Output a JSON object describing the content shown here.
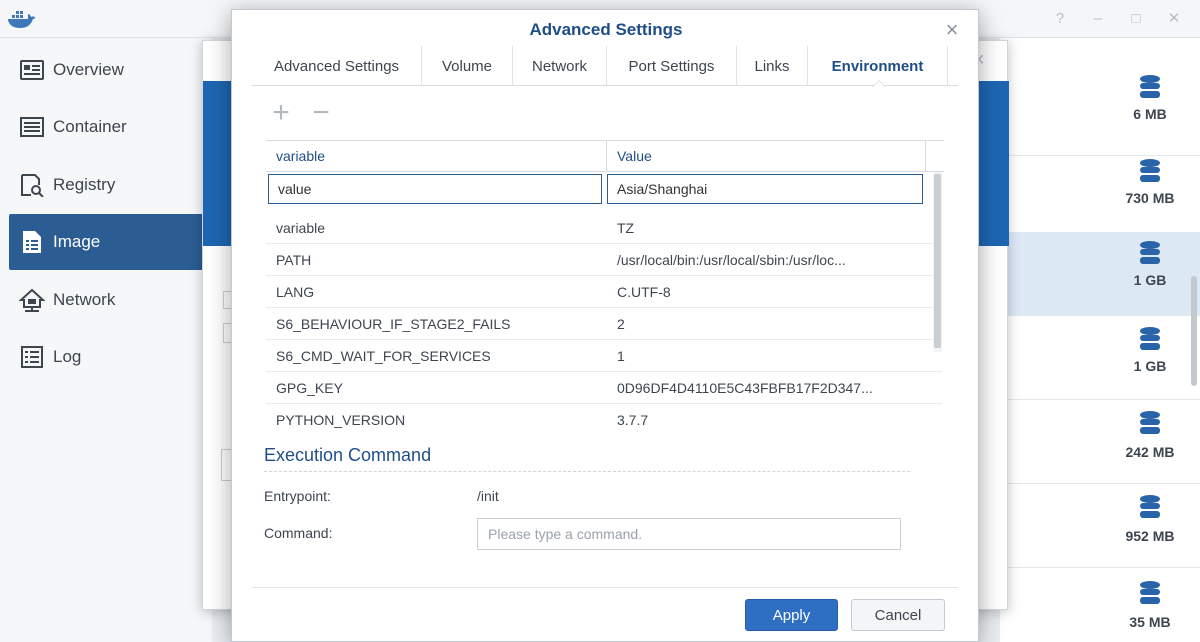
{
  "window": {
    "controls": [
      "?",
      "–",
      "□",
      "✕"
    ]
  },
  "sidebar": {
    "items": [
      {
        "label": "Overview",
        "icon": "overview-icon",
        "active": false
      },
      {
        "label": "Container",
        "icon": "container-icon",
        "active": false
      },
      {
        "label": "Registry",
        "icon": "registry-icon",
        "active": false
      },
      {
        "label": "Image",
        "icon": "image-icon",
        "active": true
      },
      {
        "label": "Network",
        "icon": "network-icon",
        "active": false
      },
      {
        "label": "Log",
        "icon": "log-icon",
        "active": false
      }
    ]
  },
  "image_sizes": [
    "6 MB",
    "730 MB",
    "1 GB",
    "1 GB",
    "242 MB",
    "952 MB",
    "35 MB"
  ],
  "modal": {
    "title": "Advanced Settings",
    "close": "×",
    "tabs": [
      "Advanced Settings",
      "Volume",
      "Network",
      "Port Settings",
      "Links",
      "Environment"
    ],
    "active_tab": "Environment",
    "add": "+",
    "remove": "−",
    "grid": {
      "headers": [
        "variable",
        "Value"
      ],
      "editing": {
        "variable": "value",
        "value": "Asia/Shanghai"
      },
      "rows": [
        {
          "variable": "variable",
          "value": "TZ"
        },
        {
          "variable": "PATH",
          "value": "/usr/local/bin:/usr/local/sbin:/usr/loc..."
        },
        {
          "variable": "LANG",
          "value": "C.UTF-8"
        },
        {
          "variable": "S6_BEHAVIOUR_IF_STAGE2_FAILS",
          "value": "2"
        },
        {
          "variable": "S6_CMD_WAIT_FOR_SERVICES",
          "value": "1"
        },
        {
          "variable": "GPG_KEY",
          "value": "0D96DF4D4110E5C43FBFB17F2D347..."
        },
        {
          "variable": "PYTHON_VERSION",
          "value": "3.7.7"
        }
      ]
    },
    "execution": {
      "title": "Execution Command",
      "entrypoint_label": "Entrypoint:",
      "entrypoint_value": "/init",
      "command_label": "Command:",
      "command_placeholder": "Please type a command.",
      "command_value": ""
    },
    "buttons": {
      "apply": "Apply",
      "cancel": "Cancel"
    }
  },
  "colors": {
    "accent": "#2f6fc3",
    "title": "#1f4e86",
    "sidebar_active": "#2b5d93",
    "header_blue": "#1e66b3"
  }
}
